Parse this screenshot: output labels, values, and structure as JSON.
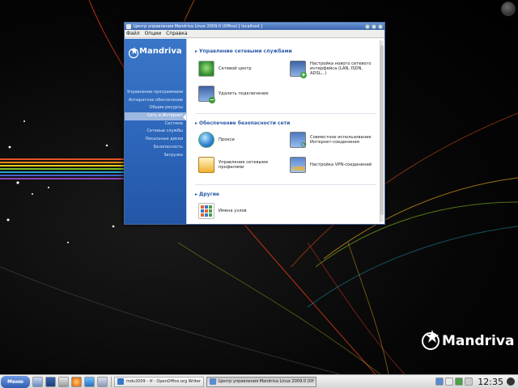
{
  "window": {
    "title": "Центр управления Mandriva Linux 2009.0 (Office) [ localhost ]",
    "menu": [
      "Файл",
      "Опции",
      "Справка"
    ]
  },
  "sidebar": {
    "logo": "Mandriva",
    "items": [
      {
        "label": "Управление программами",
        "active": false
      },
      {
        "label": "Аппаратное обеспечение",
        "active": false
      },
      {
        "label": "Общие ресурсы",
        "active": false
      },
      {
        "label": "Сеть и Интернет",
        "active": true
      },
      {
        "label": "Система",
        "active": false
      },
      {
        "label": "Сетевые службы",
        "active": false
      },
      {
        "label": "Локальные диски",
        "active": false
      },
      {
        "label": "Безопасность",
        "active": false
      },
      {
        "label": "Загрузка",
        "active": false
      }
    ]
  },
  "sections": [
    {
      "title": "Управление сетевыми службами",
      "items": [
        {
          "label": "Сетевой центр",
          "icon": "network-center-icon"
        },
        {
          "label": "Настройка нового сетевого интерфейса (LAN, ISDN, ADSL...)",
          "icon": "new-interface-icon"
        },
        {
          "label": "Удалить подключение",
          "icon": "remove-connection-icon"
        }
      ]
    },
    {
      "title": "Обеспечение безопасности сети",
      "items": [
        {
          "label": "Прокси",
          "icon": "proxy-globe-icon"
        },
        {
          "label": "Совместное использование Интернет-соединения",
          "icon": "internet-sharing-icon"
        },
        {
          "label": "Управление сетевыми профилями",
          "icon": "network-profiles-icon"
        },
        {
          "label": "Настройка VPN-соединений",
          "icon": "vpn-icon"
        }
      ]
    },
    {
      "title": "Другие",
      "items": [
        {
          "label": "Имена узлов",
          "icon": "hostnames-icon"
        }
      ]
    }
  ],
  "desktop": {
    "logo": "Mandriva"
  },
  "taskbar": {
    "menu_label": "Меню",
    "tasks": [
      {
        "label": "mdv2009 - tf - OpenOffice.org Writer",
        "active": false
      },
      {
        "label": "Центр управления Mandriva Linux 2009.0 (Of",
        "active": true
      }
    ],
    "clock": "12:35"
  },
  "colors": {
    "accent": "#2c5aa8",
    "sidebar": "#2b64b8",
    "titlebar": "#3a66b0"
  }
}
